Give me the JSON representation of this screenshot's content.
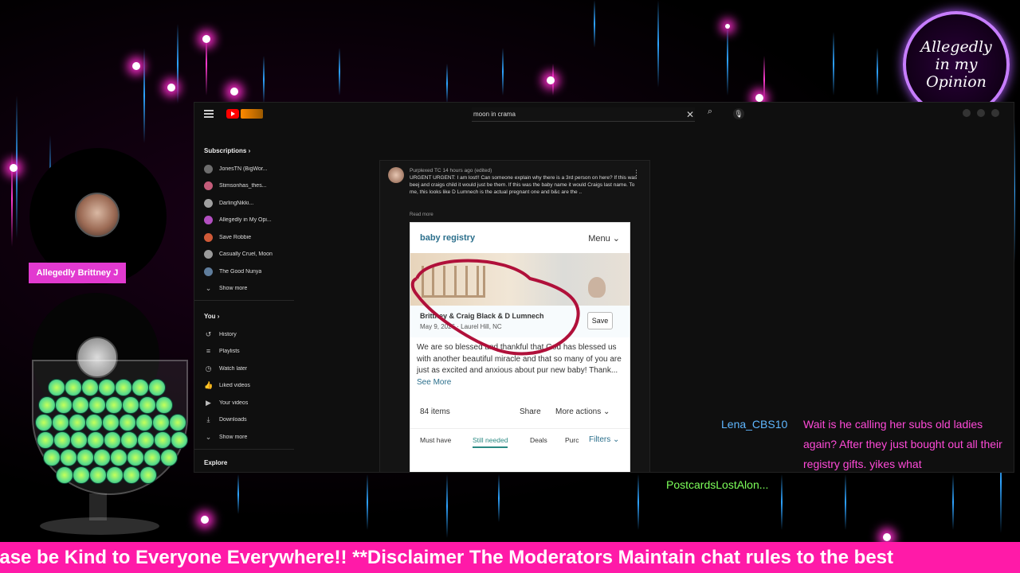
{
  "overlay": {
    "logo_text": "Allegedly in my Opinion",
    "host_name": "Allegedly Brittney J",
    "ticker": "ease be Kind to Everyone Everywhere!! **Disclaimer The Moderators Maintain chat rules to the best"
  },
  "browser": {
    "search_query": "moon in crama",
    "sidebar": {
      "subscriptions_label": "Subscriptions",
      "subscriptions": [
        {
          "label": "JonesTN (BigWor...",
          "color": "#6d6d6d"
        },
        {
          "label": "Stimsonhas_thes...",
          "color": "#c45c7a"
        },
        {
          "label": "DarlingNikki...",
          "color": "#a0a0a0"
        },
        {
          "label": "Allegedly in My Opi...",
          "color": "#b24fc0"
        },
        {
          "label": "Save Robbie",
          "color": "#d05a38"
        },
        {
          "label": "Casually Cruel, Moon",
          "color": "#9a9a9a"
        },
        {
          "label": "The Good Nunya",
          "color": "#5f7d9c"
        }
      ],
      "show_more_1": "Show more",
      "you_label": "You",
      "you_items": [
        {
          "label": "History",
          "icon": "history-icon",
          "glyph": "↺"
        },
        {
          "label": "Playlists",
          "icon": "playlist-icon",
          "glyph": "≡"
        },
        {
          "label": "Watch later",
          "icon": "clock-icon",
          "glyph": "◷"
        },
        {
          "label": "Liked videos",
          "icon": "thumb-up-icon",
          "glyph": "👍"
        },
        {
          "label": "Your videos",
          "icon": "video-icon",
          "glyph": "▶"
        },
        {
          "label": "Downloads",
          "icon": "download-icon",
          "glyph": "⤓"
        }
      ],
      "show_more_2": "Show more",
      "explore_label": "Explore"
    },
    "comment": {
      "author": "Purplexed TC",
      "time": "14 hours ago (edited)",
      "text": "URGENT URGENT: I am lost!! Can someone explain why there is a 3rd person on here? If this was beej and craigs child it would just be them. If this was the baby name it would Craigs last name.  To me, this looks like D Lumnech is the actual pregnant one and b&c are the ..",
      "read_more": "Read more"
    },
    "registry": {
      "title": "baby registry",
      "menu": "Menu",
      "names": "Brittney & Craig Black & D Lumnech",
      "date_place": "May 9, 2026 · Laurel Hill, NC",
      "save": "Save",
      "blurb": "We are so blessed and thankful that God has blessed us with another beautiful miracle and that so many of you are just as excited and anxious about pur new baby! Thank...",
      "see_more": "See More",
      "items": "84 items",
      "share": "Share",
      "more_actions": "More actions",
      "chips": [
        "Must have",
        "Still needed",
        "Deals",
        "Purc"
      ],
      "filters": "Filters"
    }
  },
  "chat": {
    "user1": "Lena_CBS10",
    "msg1": "Wait is he calling her subs old ladies again? After they just bought out all their registry gifts. yikes what",
    "user2": "PostcardsLostAlon..."
  },
  "colors": {
    "ticker_bg": "#ff1aa8",
    "host_badge": "#e23ad0",
    "chat_user1": "#5fb7ff",
    "chat_msg": "#ff4ad8",
    "chat_user2": "#7dff5a",
    "registry_accent": "#2b6f8c"
  }
}
